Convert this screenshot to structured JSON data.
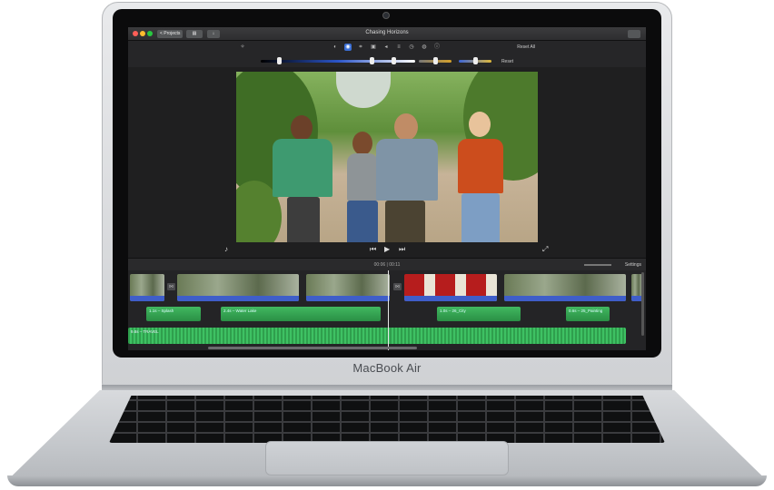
{
  "device": {
    "brand": "MacBook Air"
  },
  "window": {
    "title": "Chasing Horizons",
    "projects_label": "< Projects"
  },
  "toolbar": {
    "reset_all": "Reset All",
    "reset": "Reset"
  },
  "viewer": {
    "timecode": "00:06 | 00:11",
    "settings": "Settings"
  },
  "timeline": {
    "audio_clips": [
      {
        "label": "1.1s – Splash"
      },
      {
        "label": "2.4s – Water Lake"
      },
      {
        "label": "1.0s – 26_City"
      },
      {
        "label": "0.6s – 25_Painting"
      }
    ],
    "music_label": "9.8s – TRAVEL"
  },
  "colors": {
    "accent": "#3b6fd6",
    "audio": "#3ec163",
    "video_strip": "#3f5ec9"
  },
  "icons": [
    "microphone-icon",
    "skip-back-icon",
    "play-icon",
    "skip-forward-icon",
    "fullscreen-icon",
    "share-icon",
    "magic-wand-icon",
    "color-balance-icon",
    "color-correction-icon",
    "crop-icon",
    "stabilization-icon",
    "volume-icon",
    "equalizer-icon",
    "speed-icon",
    "noise-reduction-icon",
    "info-icon"
  ]
}
